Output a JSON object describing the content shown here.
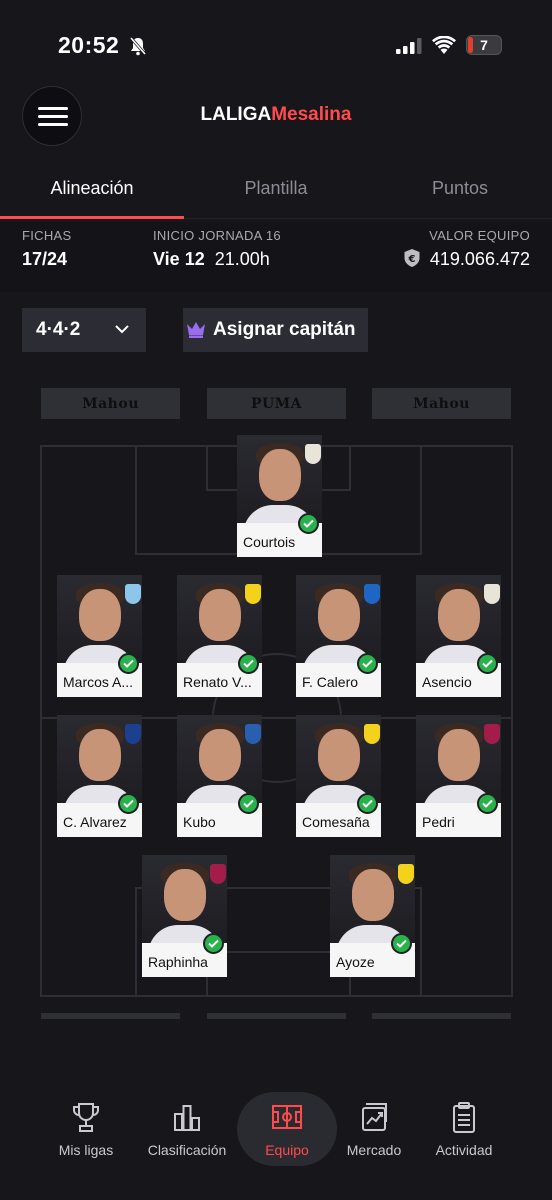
{
  "status_bar": {
    "time": "20:52",
    "battery": "7"
  },
  "header": {
    "brand_part1": "LALIGA",
    "brand_part2": "Mesalina"
  },
  "tabs": [
    {
      "label": "Alineación",
      "active": true
    },
    {
      "label": "Plantilla",
      "active": false
    },
    {
      "label": "Puntos",
      "active": false
    }
  ],
  "info": {
    "fichas_label": "FICHAS",
    "fichas_value": "17/24",
    "jornada_label": "INICIO JORNADA 16",
    "jornada_day": "Vie 12",
    "jornada_time": "21.00h",
    "valor_label": "VALOR EQUIPO",
    "valor_value": "419.066.472"
  },
  "controls": {
    "formation": "4·4·2",
    "captain_label": "Asignar capitán"
  },
  "sponsors": [
    "Mahou",
    "PUMA",
    "Mahou"
  ],
  "players": {
    "gk": [
      {
        "name": "Courtois",
        "club": "real-madrid"
      }
    ],
    "def": [
      {
        "name": "Marcos A...",
        "club": "celta"
      },
      {
        "name": "Renato V...",
        "club": "villarreal"
      },
      {
        "name": "F. Calero",
        "club": "espanyol"
      },
      {
        "name": "Asencio",
        "club": "real-madrid"
      }
    ],
    "mid": [
      {
        "name": "C. Alvarez",
        "club": "levante"
      },
      {
        "name": "Kubo",
        "club": "real-sociedad"
      },
      {
        "name": "Comesaña",
        "club": "villarreal"
      },
      {
        "name": "Pedri",
        "club": "barcelona"
      }
    ],
    "fwd": [
      {
        "name": "Raphinha",
        "club": "barcelona"
      },
      {
        "name": "Ayoze",
        "club": "villarreal"
      }
    ]
  },
  "colors": {
    "accent": "#ff4b4b",
    "check": "#27b24a",
    "real-madrid": "#e8e4d8",
    "celta": "#8ec5ea",
    "villarreal": "#f2d21b",
    "espanyol": "#1f66c4",
    "levante": "#1d3f8f",
    "real-sociedad": "#2a5fb0",
    "barcelona": "#a21d4a"
  },
  "nav": [
    {
      "label": "Mis ligas",
      "icon": "trophy-icon",
      "active": false
    },
    {
      "label": "Clasificación",
      "icon": "bar-chart-icon",
      "active": false
    },
    {
      "label": "Equipo",
      "icon": "pitch-icon",
      "active": true
    },
    {
      "label": "Mercado",
      "icon": "market-icon",
      "active": false
    },
    {
      "label": "Actividad",
      "icon": "clipboard-icon",
      "active": false
    }
  ]
}
